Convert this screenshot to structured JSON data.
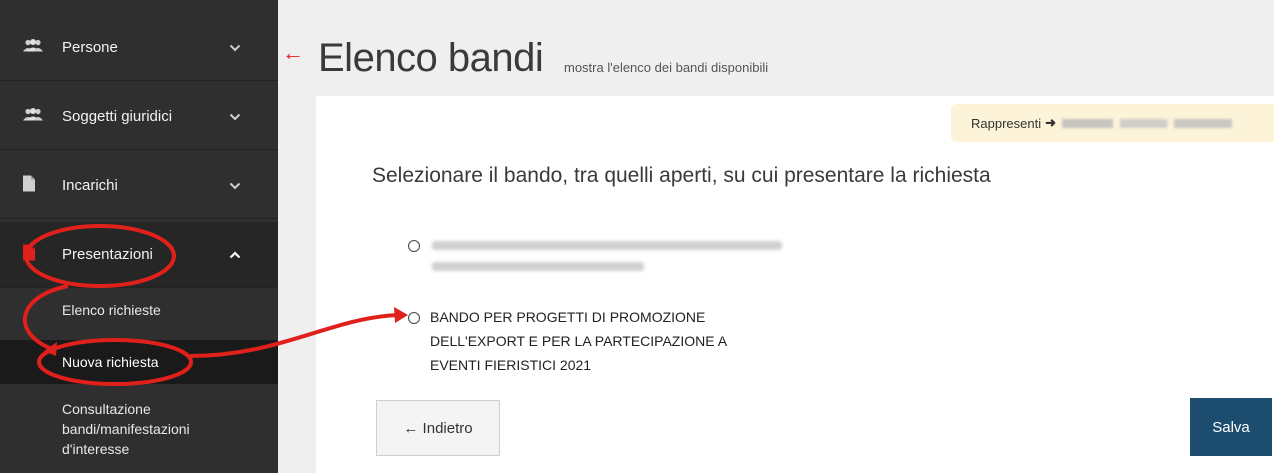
{
  "sidebar": {
    "items": [
      {
        "label": "Persone",
        "icon": "users-icon"
      },
      {
        "label": "Soggetti giuridici",
        "icon": "users-icon"
      },
      {
        "label": "Incarichi",
        "icon": "file-icon"
      },
      {
        "label": "Presentazioni",
        "icon": "file-icon"
      }
    ],
    "subitems": [
      {
        "label": "Elenco richieste"
      },
      {
        "label": "Nuova richiesta"
      },
      {
        "label": "Consultazione bandi/manifestazioni d'interesse"
      }
    ]
  },
  "header": {
    "title": "Elenco bandi",
    "subtitle": "mostra l'elenco dei bandi disponibili"
  },
  "rappresenti": {
    "label": "Rappresenti"
  },
  "main": {
    "question": "Selezionare il bando, tra quelli aperti, su cui presentare la richiesta",
    "option2": "BANDO PER PROGETTI DI PROMOZIONE DELL'EXPORT E PER LA PARTECIPAZIONE A EVENTI FIERISTICI 2021"
  },
  "buttons": {
    "back_label": "← Indietro",
    "save_label": "Salva"
  },
  "colors": {
    "sidebar_bg": "#2f2f2f",
    "accent_red": "#e0201b",
    "save_bg": "#1d4d6e",
    "rappresenti_bg": "#fdf3d8"
  }
}
